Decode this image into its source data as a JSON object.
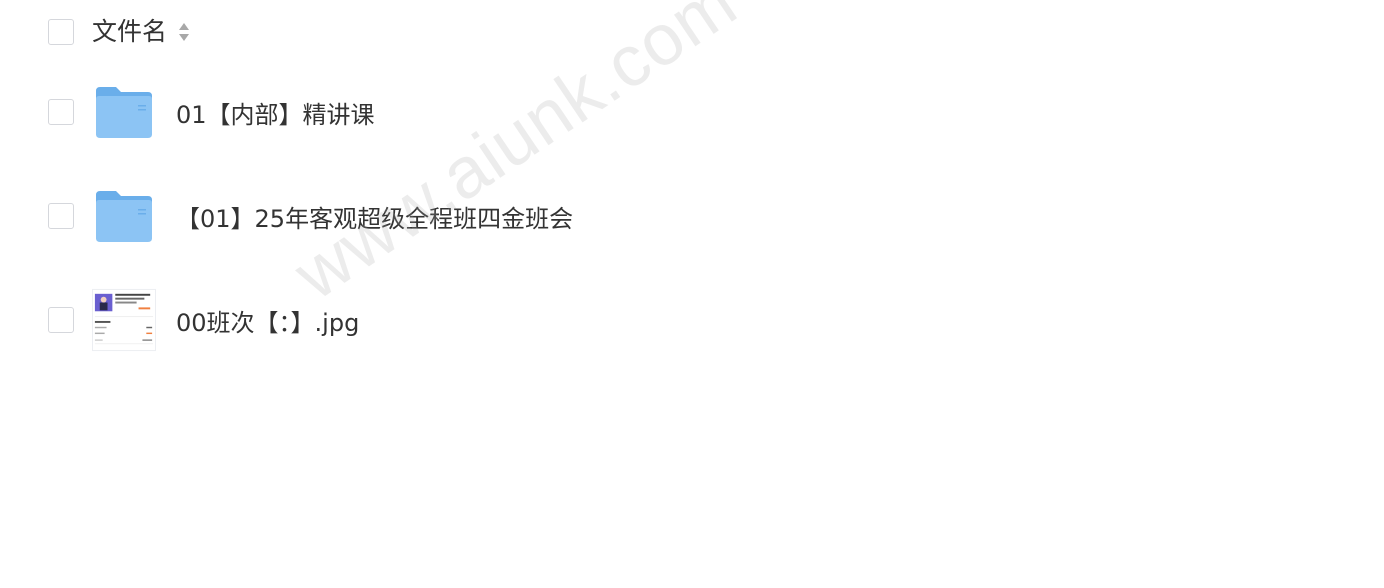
{
  "header": {
    "column_label": "文件名"
  },
  "files": [
    {
      "name": "01【内部】精讲课",
      "type": "folder"
    },
    {
      "name": "【01】25年客观超级全程班四金班会",
      "type": "folder"
    },
    {
      "name": "00班次【：】.jpg",
      "type": "image"
    }
  ],
  "watermark": "www.aiunk.com",
  "colors": {
    "folder_front": "#8cc4f4",
    "folder_back": "#6aaeea",
    "text": "#333333",
    "checkbox_border": "#d5d7dc"
  }
}
